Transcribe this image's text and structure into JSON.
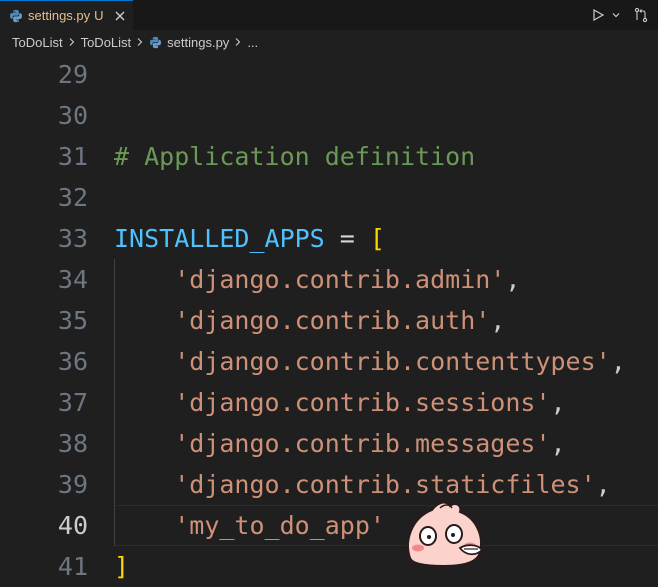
{
  "tab": {
    "filename": "settings.py",
    "status": "U",
    "icon": "python-file-icon"
  },
  "breadcrumb": {
    "items": [
      "ToDoList",
      "ToDoList",
      "settings.py",
      "..."
    ]
  },
  "editor": {
    "lines": [
      {
        "number": "29",
        "tokens": []
      },
      {
        "number": "30",
        "tokens": []
      },
      {
        "number": "31",
        "tokens": [
          {
            "text": "# Application definition",
            "kind": "comment"
          }
        ]
      },
      {
        "number": "32",
        "tokens": []
      },
      {
        "number": "33",
        "tokens": [
          {
            "text": "INSTALLED_APPS",
            "kind": "var"
          },
          {
            "text": " = ",
            "kind": "op"
          },
          {
            "text": "[",
            "kind": "bracket"
          }
        ]
      },
      {
        "number": "34",
        "tokens": [
          {
            "text": "    ",
            "kind": "op"
          },
          {
            "text": "'django.contrib.admin'",
            "kind": "str"
          },
          {
            "text": ",",
            "kind": "punct"
          }
        ]
      },
      {
        "number": "35",
        "tokens": [
          {
            "text": "    ",
            "kind": "op"
          },
          {
            "text": "'django.contrib.auth'",
            "kind": "str"
          },
          {
            "text": ",",
            "kind": "punct"
          }
        ]
      },
      {
        "number": "36",
        "tokens": [
          {
            "text": "    ",
            "kind": "op"
          },
          {
            "text": "'django.contrib.contenttypes'",
            "kind": "str"
          },
          {
            "text": ",",
            "kind": "punct"
          }
        ]
      },
      {
        "number": "37",
        "tokens": [
          {
            "text": "    ",
            "kind": "op"
          },
          {
            "text": "'django.contrib.sessions'",
            "kind": "str"
          },
          {
            "text": ",",
            "kind": "punct"
          }
        ]
      },
      {
        "number": "38",
        "tokens": [
          {
            "text": "    ",
            "kind": "op"
          },
          {
            "text": "'django.contrib.messages'",
            "kind": "str"
          },
          {
            "text": ",",
            "kind": "punct"
          }
        ]
      },
      {
        "number": "39",
        "tokens": [
          {
            "text": "    ",
            "kind": "op"
          },
          {
            "text": "'django.contrib.staticfiles'",
            "kind": "str"
          },
          {
            "text": ",",
            "kind": "punct"
          }
        ]
      },
      {
        "number": "40",
        "tokens": [
          {
            "text": "    ",
            "kind": "op"
          },
          {
            "text": "'my_to_do_app'",
            "kind": "str"
          }
        ],
        "active": true
      },
      {
        "number": "41",
        "tokens": [
          {
            "text": "]",
            "kind": "bracket"
          }
        ]
      }
    ]
  },
  "colors": {
    "accent": "#0078d4",
    "comment": "#6a9955",
    "variable": "#4fc1ff",
    "string": "#ce9178",
    "bracket": "#ffd700",
    "modified": "#e2c08d"
  },
  "sticker": {
    "icon": "peach-face-sticker"
  }
}
